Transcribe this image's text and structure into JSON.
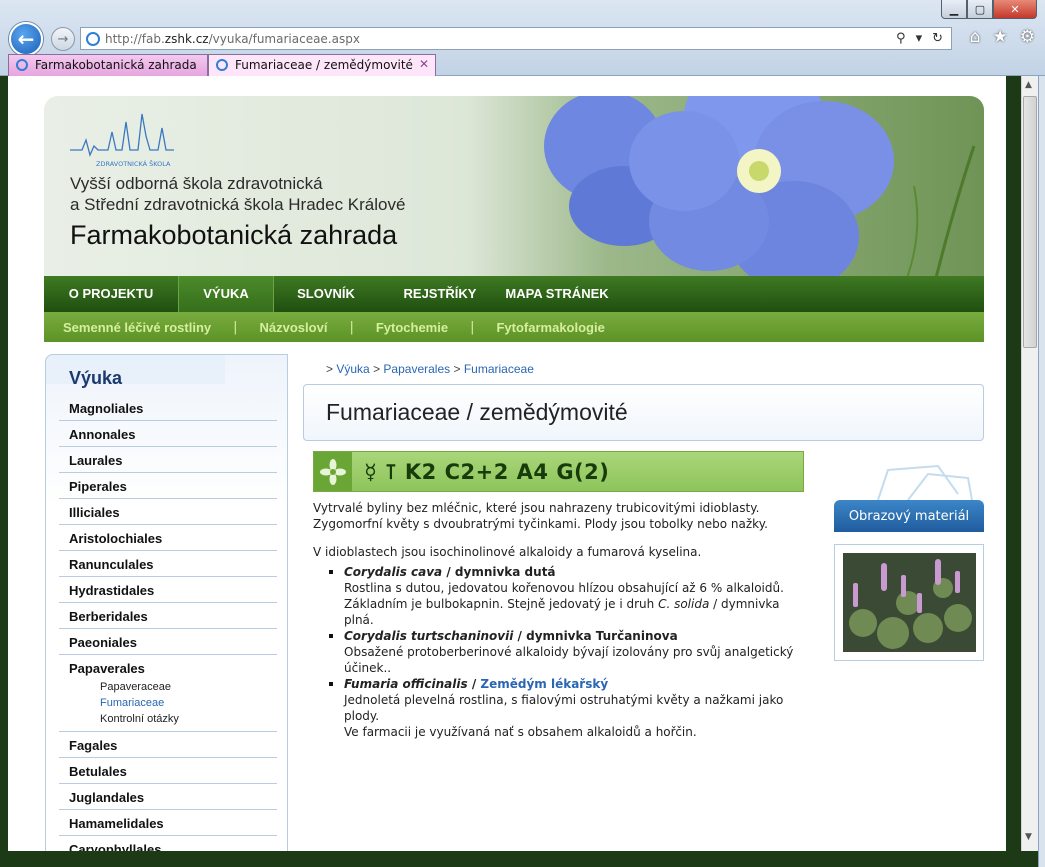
{
  "browser": {
    "url_prefix": "http://fab.",
    "url_host": "zshk.cz",
    "url_path": "/vyuka/fumariaceae.aspx",
    "window_controls": [
      "minimize-icon",
      "maximize-icon",
      "close-icon"
    ],
    "tabs": [
      {
        "label": "Farmakobotanická zahrada",
        "active": false
      },
      {
        "label": "Fumariaceae / zemědýmovité",
        "active": true
      }
    ],
    "toolbar_icons": [
      "home-icon",
      "star-icon",
      "gear-icon"
    ]
  },
  "header": {
    "logo_text": "ZDRAVOTNICKÁ ŠKOLA",
    "school_line1": "Vyšší odborná škola zdravotnická",
    "school_line2": "a Střední zdravotnická škola Hradec Králové",
    "site_title": "Farmakobotanická zahrada"
  },
  "nav": {
    "items": [
      {
        "label": "O PROJEKTU"
      },
      {
        "label": "VÝUKA"
      },
      {
        "label": "SLOVNÍK"
      },
      {
        "label": "REJSTŘÍKY"
      },
      {
        "label": "MAPA STRÁNEK"
      }
    ],
    "active_index": 1
  },
  "subnav": {
    "items": [
      {
        "label": "Semenné léčivé rostliny"
      },
      {
        "label": "Názvosloví"
      },
      {
        "label": "Fytochemie"
      },
      {
        "label": "Fytofarmakologie"
      }
    ],
    "separator": "|"
  },
  "sidebar": {
    "title": "Výuka",
    "items": [
      {
        "label": "Magnoliales"
      },
      {
        "label": "Annonales"
      },
      {
        "label": "Laurales"
      },
      {
        "label": "Piperales"
      },
      {
        "label": "Illiciales"
      },
      {
        "label": "Aristolochiales"
      },
      {
        "label": "Ranunculales"
      },
      {
        "label": "Hydrastidales"
      },
      {
        "label": "Berberidales"
      },
      {
        "label": "Paeoniales"
      },
      {
        "label": "Papaverales"
      },
      {
        "label": "Fagales"
      },
      {
        "label": "Betulales"
      },
      {
        "label": "Juglandales"
      },
      {
        "label": "Hamamelidales"
      },
      {
        "label": "Caryophyllales"
      }
    ],
    "subitems": [
      {
        "label": "Papaveraceae"
      },
      {
        "label": "Fumariaceae"
      },
      {
        "label": "Kontrolní otázky"
      }
    ]
  },
  "breadcrumb": {
    "prefix": ">",
    "items": [
      "Výuka",
      "Papaverales",
      "Fumariaceae"
    ],
    "separator": ">"
  },
  "main": {
    "title": "Fumariaceae / zemědýmovité",
    "formula": "☿ ⊺ K2 C2+2 A4 G(2)",
    "intro_line1": "Vytrvalé byliny bez mléčnic, které jsou nahrazeny trubicovitými idioblasty.",
    "intro_line2": "Zygomorfní květy s dvoubratrými tyčinkami. Plody jsou tobolky nebo nažky.",
    "alkaloids": "V idioblastech jsou isochinolinové alkaloidy a fumarová kyselina.",
    "species": [
      {
        "latin": "Corydalis cava",
        "sep": " / ",
        "common": "dymnivka dutá",
        "desc1": "Rostlina s dutou, jedovatou kořenovou hlízou obsahující až 6 % alkaloidů.",
        "desc2_a": "Základním je bulbokapnin. Stejně jedovatý je i druh ",
        "desc2_italic": "C. solida",
        "desc2_b": " / dymnivka plná."
      },
      {
        "latin": "Corydalis turtschaninovii",
        "sep": " / ",
        "common": "dymnivka Turčaninova",
        "desc1": "Obsažené protoberberinové alkaloidy bývají izolovány pro svůj analgetický účinek.."
      },
      {
        "latin": "Fumaria officinalis",
        "sep": " / ",
        "common": "Zemědým lékařský",
        "desc1": "Jednoletá plevelná rostlina, s fialovými ostruhatými květy a nažkami jako plody.",
        "desc2": "Ve farmacii je využívaná nať s obsahem alkaloidů a hořčin."
      }
    ]
  },
  "right_panel": {
    "header": "Obrazový materiál"
  },
  "colors": {
    "nav_green": "#2c6416",
    "subnav_green": "#6aa035",
    "link_blue": "#2a66b3",
    "formula_bg": "#9ccd6a"
  }
}
